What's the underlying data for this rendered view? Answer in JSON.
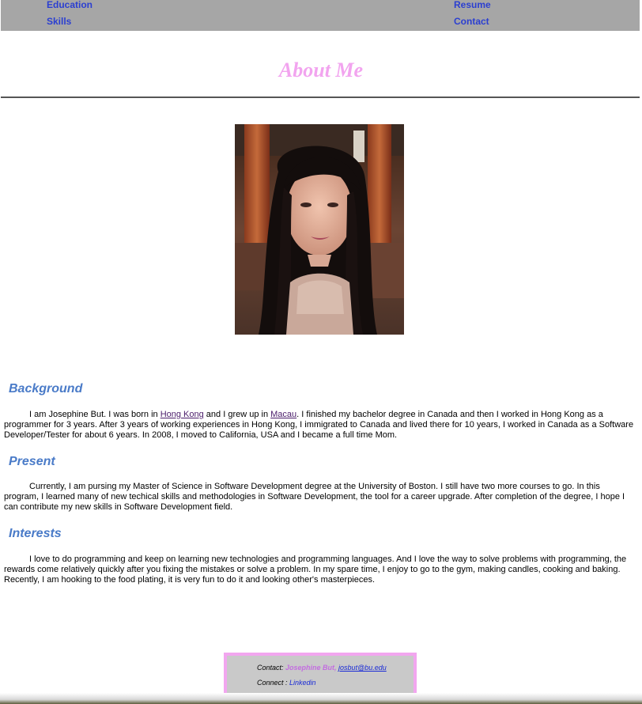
{
  "nav": {
    "education": "Education",
    "skills": "Skills",
    "resume": "Resume",
    "contact": "Contact"
  },
  "page_title": "About Me",
  "photo": {
    "description": "portrait-photo"
  },
  "sections": {
    "background": {
      "heading": "Background",
      "text_pre": "I am Josephine But. I was born in ",
      "link1": "Hong Kong",
      "text_mid": " and I grew up in ",
      "link2": "Macau",
      "text_post": ". I finished my bachelor degree in Canada and then I worked in Hong Kong as a programmer for 3 years. After 3 years of working experiences in Hong Kong, I immigrated to Canada and lived there for 10 years, I worked in Canada as a Software Developer/Tester for about 6 years. In 2008, I moved to California, USA and I became a full time Mom."
    },
    "present": {
      "heading": "Present",
      "text": "Currently, I am pursing my Master of Science in Software Development degree at the University of Boston. I still have two more courses to go. In this program, I learned many of new techical skills and methodologies in Software Development, the tool for a career upgrade. After completion of the degree, I hope I can contribute my new skills in Software Development field."
    },
    "interests": {
      "heading": "Interests",
      "text": "I love to do programming and keep on learning new technologies and programming languages. And I love the way to solve problems with programming, the rewards come relatively quickly after you fixing the mistakes or solve a problem. In my spare time, I enjoy to go to the gym, making candles, cooking and baking. Recently, I am hooking to the food plating, it is very fun to do it and looking other's masterpieces."
    }
  },
  "footer": {
    "contact_label": "Contact: ",
    "name": "Josephine But, ",
    "email": "josbut@bu.edu",
    "connect_label": "Connect : ",
    "linkedin": "Linkedin"
  },
  "colors": {
    "nav_bg": "#a6a6a6",
    "nav_link": "#2b3fd1",
    "title": "#f2a4ef",
    "heading": "#4a7bc8",
    "footer_border": "#f2a6ef"
  }
}
